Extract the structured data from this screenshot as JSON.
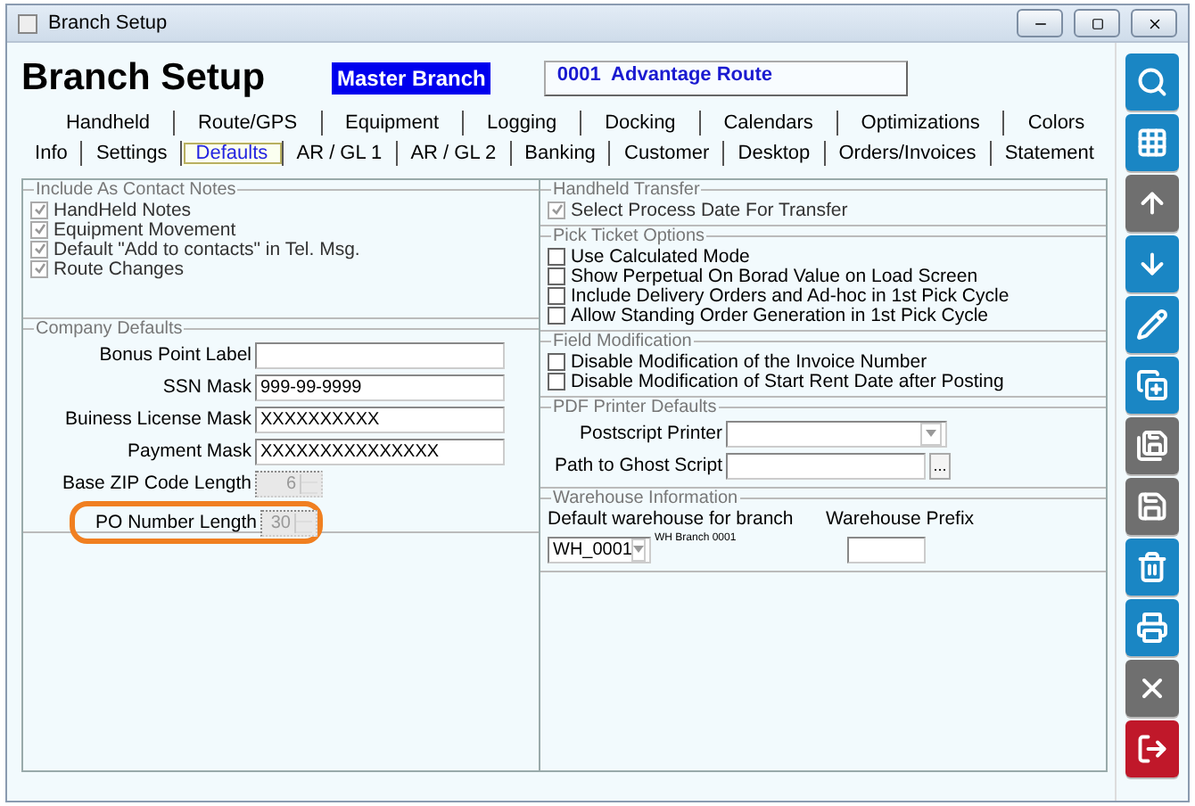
{
  "window": {
    "title": "Branch Setup"
  },
  "header": {
    "title": "Branch Setup",
    "branch": "Master Branch",
    "route": "0001  Advantage Route"
  },
  "tab_rows": [
    [
      {
        "label": "Handheld",
        "selected": false
      },
      {
        "label": "Route/GPS",
        "selected": false
      },
      {
        "label": "Equipment",
        "selected": false
      },
      {
        "label": "Logging",
        "selected": false
      },
      {
        "label": "Docking",
        "selected": false
      },
      {
        "label": "Calendars",
        "selected": false
      },
      {
        "label": "Optimizations",
        "selected": false
      },
      {
        "label": "Colors",
        "selected": false
      }
    ],
    [
      {
        "label": "Info",
        "selected": false
      },
      {
        "label": "Settings",
        "selected": false
      },
      {
        "label": "Defaults",
        "selected": true
      },
      {
        "label": "AR / GL 1",
        "selected": false
      },
      {
        "label": "AR / GL 2",
        "selected": false
      },
      {
        "label": "Banking",
        "selected": false
      },
      {
        "label": "Customer",
        "selected": false
      },
      {
        "label": "Desktop",
        "selected": false
      },
      {
        "label": "Orders/Invoices",
        "selected": false
      },
      {
        "label": "Statement",
        "selected": false
      }
    ]
  ],
  "contact_notes": {
    "legend": "Include As Contact Notes",
    "items": [
      {
        "label": "HandHeld Notes",
        "checked": true,
        "disabled": true
      },
      {
        "label": "Equipment Movement",
        "checked": true,
        "disabled": true
      },
      {
        "label": "Default \"Add to contacts\" in Tel. Msg.",
        "checked": true,
        "disabled": true
      },
      {
        "label": "Route Changes",
        "checked": true,
        "disabled": true
      }
    ]
  },
  "company_defaults": {
    "legend": "Company Defaults",
    "fields": [
      {
        "label": "Bonus Point Label",
        "kind": "text",
        "disabled": false,
        "highlighted": false
      },
      {
        "label": "SSN Mask",
        "kind": "text",
        "value": "999-99-9999",
        "disabled": false,
        "highlighted": false
      },
      {
        "label": "Buiness License Mask",
        "kind": "text",
        "value": "XXXXXXXXXX",
        "disabled": false,
        "highlighted": false
      },
      {
        "label": "Payment Mask",
        "kind": "text",
        "value": "XXXXXXXXXXXXXXX",
        "disabled": false,
        "highlighted": false
      },
      {
        "label": "Base ZIP Code Length",
        "kind": "spinner",
        "value": "6",
        "disabled": true,
        "highlighted": false
      },
      {
        "label": "PO Number Length",
        "kind": "spinner",
        "value": "30",
        "disabled": true,
        "highlighted": true
      }
    ]
  },
  "check_sections": [
    {
      "legend": "Handheld Transfer",
      "items": [
        {
          "label": "Select Process Date For Transfer",
          "checked": true,
          "disabled": true
        }
      ]
    },
    {
      "legend": "Pick Ticket Options",
      "items": [
        {
          "label": "Use Calculated Mode",
          "checked": false,
          "disabled": false
        },
        {
          "label": "Show Perpetual On Borad Value on Load Screen",
          "checked": false,
          "disabled": false
        },
        {
          "label": "Include Delivery Orders and Ad-hoc in 1st Pick Cycle",
          "checked": false,
          "disabled": false
        },
        {
          "label": "Allow Standing Order Generation in 1st Pick Cycle",
          "checked": false,
          "disabled": false
        }
      ]
    },
    {
      "legend": "Field Modification",
      "items": [
        {
          "label": "Disable Modification of the Invoice Number",
          "checked": false,
          "disabled": false
        },
        {
          "label": "Disable Modification of Start Rent Date after Posting",
          "checked": false,
          "disabled": false
        }
      ]
    }
  ],
  "pdf_printer": {
    "legend": "PDF Printer Defaults",
    "printer_label": "Postscript Printer",
    "ghost_label": "Path to Ghost Script",
    "browse": "..."
  },
  "warehouse": {
    "legend": "Warehouse Information",
    "default_label": "Default warehouse for branch",
    "default_value": "WH_0001",
    "default_caption": "WH Branch 0001",
    "prefix_label": "Warehouse Prefix"
  },
  "toolbar": [
    {
      "kind": "search",
      "disabled": false
    },
    {
      "kind": "grid",
      "disabled": false
    },
    {
      "kind": "up",
      "disabled": true
    },
    {
      "kind": "down",
      "disabled": false
    },
    {
      "kind": "edit",
      "disabled": false
    },
    {
      "kind": "copy",
      "disabled": false
    },
    {
      "kind": "new",
      "disabled": true
    },
    {
      "kind": "save",
      "disabled": true
    },
    {
      "kind": "delete",
      "disabled": false
    },
    {
      "kind": "print",
      "disabled": false
    },
    {
      "kind": "cancel",
      "disabled": true
    },
    {
      "kind": "exit",
      "disabled": false
    }
  ]
}
